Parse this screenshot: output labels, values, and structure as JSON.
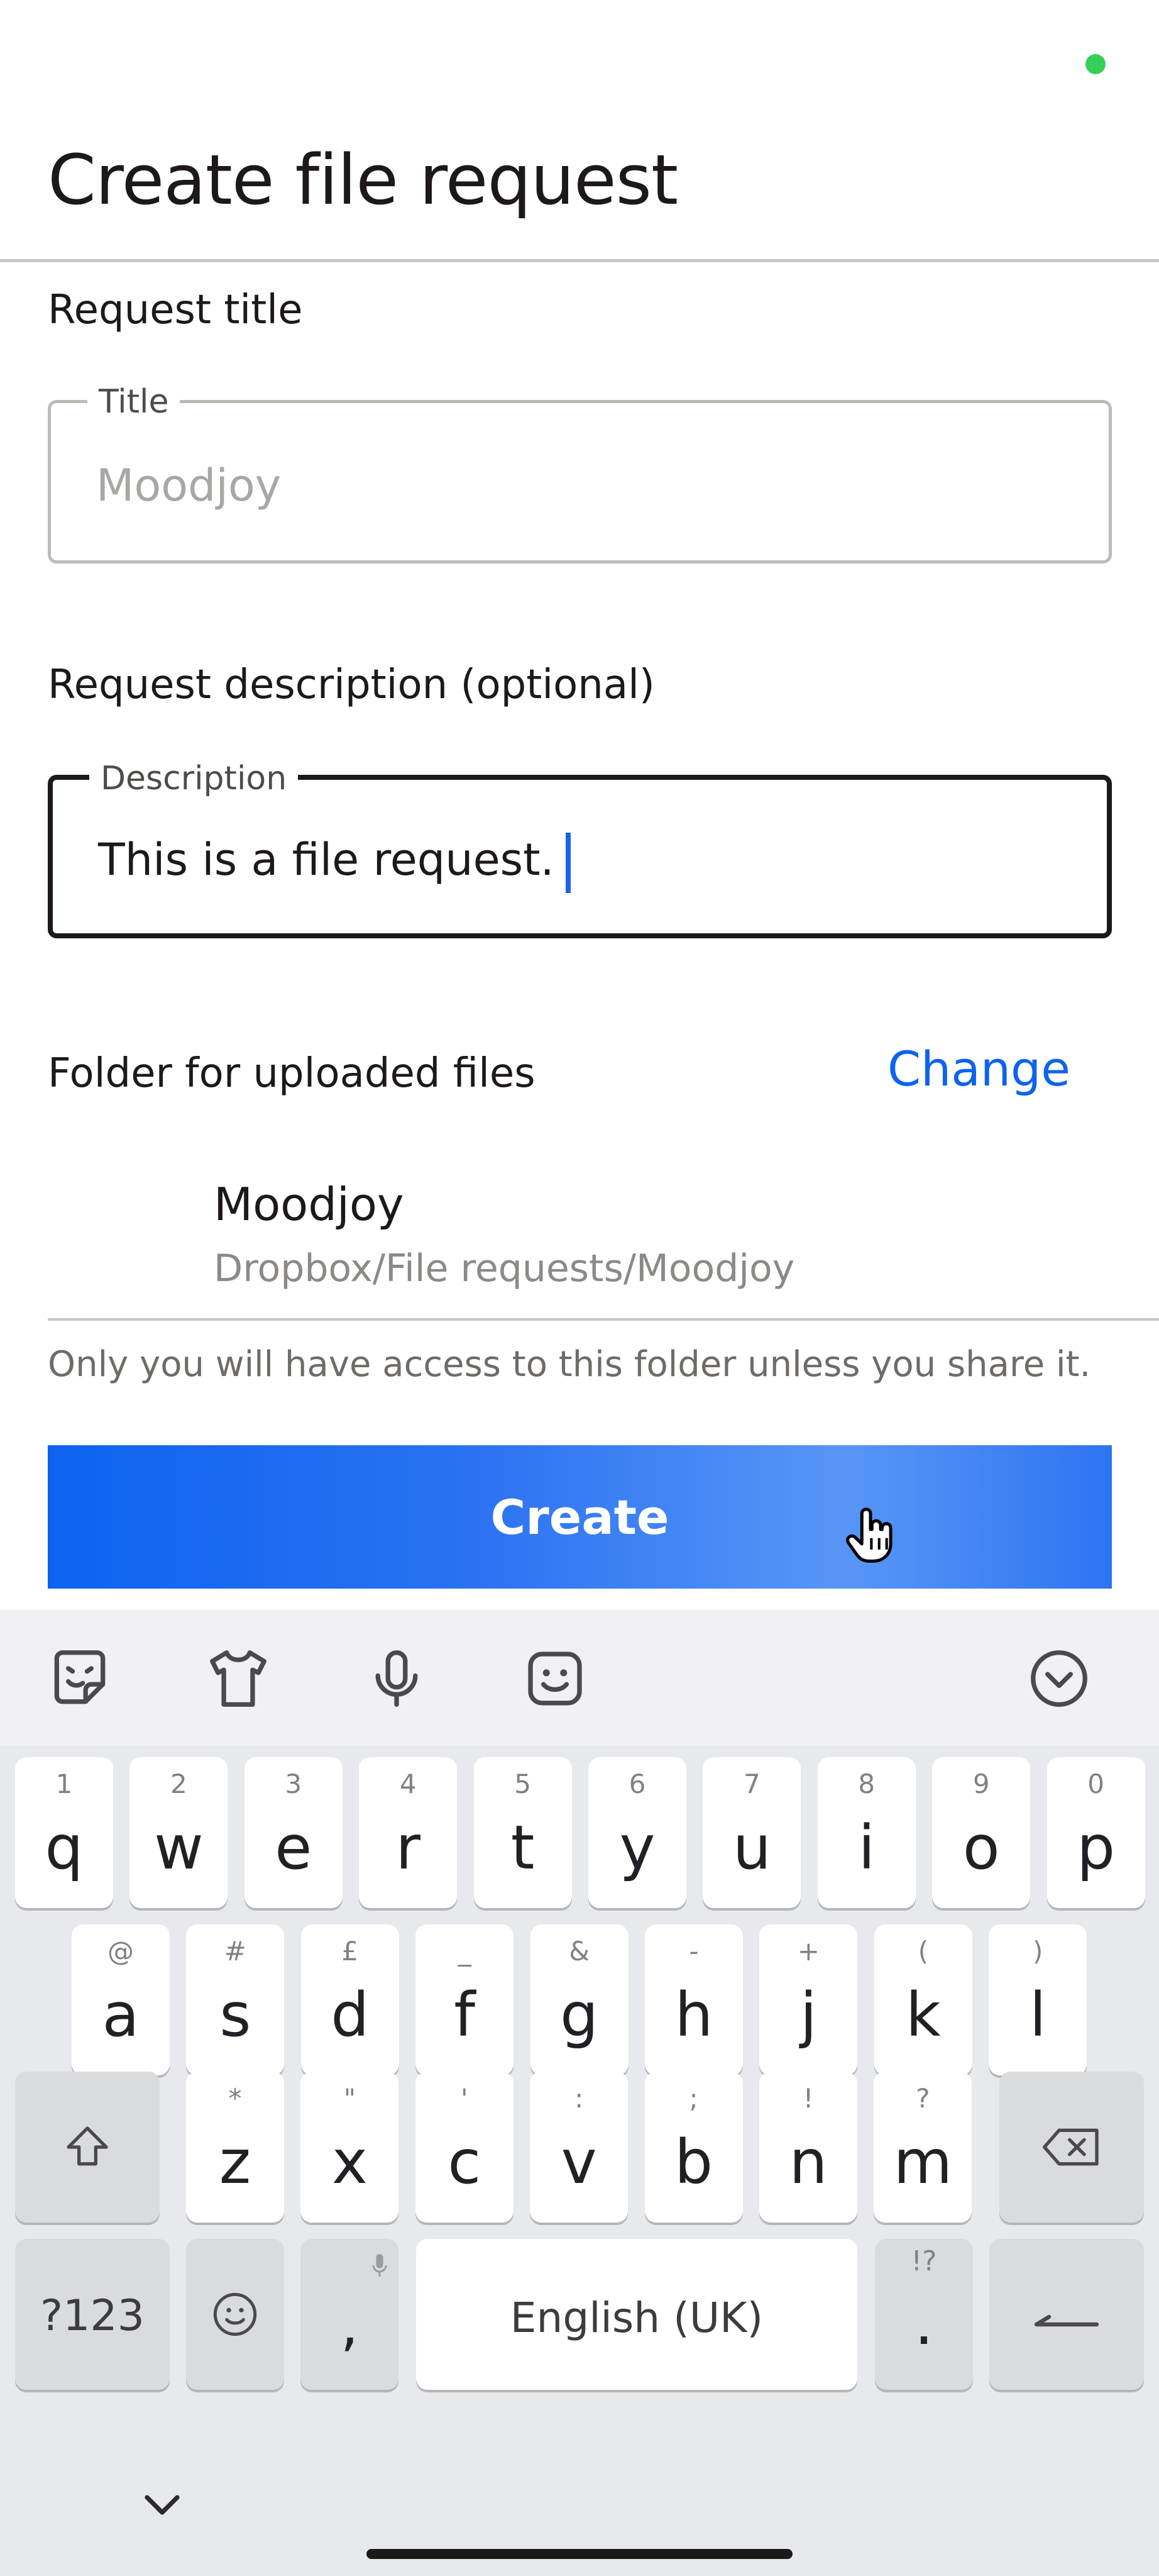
{
  "header": {
    "title": "Create file request"
  },
  "request_title": {
    "section_label": "Request title",
    "field_label": "Title",
    "placeholder": "Moodjoy"
  },
  "request_description": {
    "section_label": "Request description (optional)",
    "field_label": "Description",
    "value": "This is a file request."
  },
  "folder": {
    "section_label": "Folder for uploaded files",
    "change_label": "Change",
    "name": "Moodjoy",
    "path": "Dropbox/File requests/Moodjoy",
    "note": "Only you will have access to this folder unless you share it."
  },
  "create_button": {
    "label": "Create"
  },
  "keyboard": {
    "toolbar_icons": [
      "sticker-icon",
      "theme-shirt-icon",
      "microphone-icon",
      "emoji-icon",
      "collapse-keyboard-icon"
    ],
    "row1": [
      {
        "key": "q",
        "hint": "1"
      },
      {
        "key": "w",
        "hint": "2"
      },
      {
        "key": "e",
        "hint": "3"
      },
      {
        "key": "r",
        "hint": "4"
      },
      {
        "key": "t",
        "hint": "5"
      },
      {
        "key": "y",
        "hint": "6"
      },
      {
        "key": "u",
        "hint": "7"
      },
      {
        "key": "i",
        "hint": "8"
      },
      {
        "key": "o",
        "hint": "9"
      },
      {
        "key": "p",
        "hint": "0"
      }
    ],
    "row2": [
      {
        "key": "a",
        "hint": "@"
      },
      {
        "key": "s",
        "hint": "#"
      },
      {
        "key": "d",
        "hint": "£"
      },
      {
        "key": "f",
        "hint": "_"
      },
      {
        "key": "g",
        "hint": "&"
      },
      {
        "key": "h",
        "hint": "-"
      },
      {
        "key": "j",
        "hint": "+"
      },
      {
        "key": "k",
        "hint": "("
      },
      {
        "key": "l",
        "hint": ")"
      }
    ],
    "row3": [
      {
        "key": "z",
        "hint": "*"
      },
      {
        "key": "x",
        "hint": "\""
      },
      {
        "key": "c",
        "hint": "'"
      },
      {
        "key": "v",
        "hint": ":"
      },
      {
        "key": "b",
        "hint": ";"
      },
      {
        "key": "n",
        "hint": "!"
      },
      {
        "key": "m",
        "hint": "?"
      }
    ],
    "symbols_label": "?123",
    "comma_label": ",",
    "space_label": "English (UK)",
    "period_label": ".",
    "period_hint": "!?"
  }
}
